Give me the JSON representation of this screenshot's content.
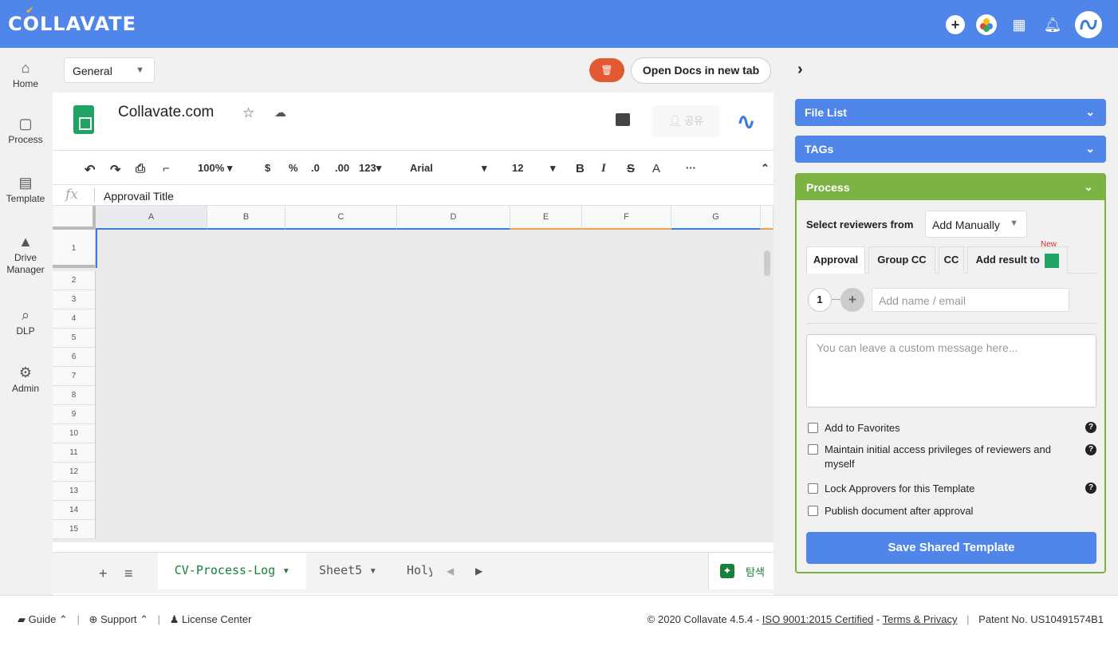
{
  "app": {
    "logo_text": "COLLAVATE",
    "brand_color": "#5085e9"
  },
  "header_icons": [
    "add-icon",
    "apps-bubbles-icon",
    "grid-icon",
    "bell-icon",
    "avatar"
  ],
  "sidebar": {
    "items": [
      {
        "label": "Home",
        "icon": "home-icon"
      },
      {
        "label": "Process",
        "icon": "process-icon"
      },
      {
        "label": "Template",
        "icon": "template-icon"
      },
      {
        "label": "Drive Manager",
        "icon": "drive-icon"
      },
      {
        "label": "DLP",
        "icon": "dlp-icon"
      },
      {
        "label": "Admin",
        "icon": "admin-icon"
      }
    ]
  },
  "main": {
    "category_select": "General",
    "open_docs_label": "Open Docs in new tab"
  },
  "doc": {
    "title": "Collavate.com",
    "share_label": "공유",
    "toolbar": {
      "zoom": "100%",
      "currency": "$",
      "percent": "%",
      "dec_decrease": ".0",
      "dec_increase": ".00",
      "number_format": "123",
      "font": "Arial",
      "font_size": "12",
      "bold": "B",
      "italic": "I",
      "strike": "S",
      "text_color": "A",
      "more": "···"
    },
    "formula_value": "Approvail Title",
    "columns": [
      "A",
      "B",
      "C",
      "D",
      "E",
      "F",
      "G"
    ],
    "rows": [
      "1",
      "2",
      "3",
      "4",
      "5",
      "6",
      "7",
      "8",
      "9",
      "10",
      "11",
      "12",
      "13",
      "14",
      "15"
    ],
    "sheet_tabs": {
      "active": "CV-Process-Log",
      "other1": "Sheet5",
      "other2": "Holy"
    },
    "explore_label": "탐색"
  },
  "right_panel": {
    "file_list": "File List",
    "tags": "TAGs",
    "process": {
      "title": "Process",
      "select_label": "Select reviewers from",
      "select_value": "Add Manually",
      "tabs": [
        "Approval",
        "Group CC",
        "CC",
        "Add result to"
      ],
      "new_badge": "New",
      "step_number": "1",
      "name_placeholder": "Add name / email",
      "message_placeholder": "You can leave a custom message here...",
      "checkboxes": [
        "Add to Favorites",
        "Maintain initial access privileges of reviewers and myself",
        "Lock Approvers for this Template",
        "Publish document after approval"
      ],
      "save_label": "Save Shared Template"
    }
  },
  "footer": {
    "guide": "Guide",
    "support": "Support",
    "license": "License Center",
    "copyright": "© 2020 Collavate 4.5.4 - ",
    "iso": "ISO 9001:2015 Certified",
    "dash": " - ",
    "terms": "Terms & Privacy",
    "patent": "Patent No. US10491574B1"
  }
}
